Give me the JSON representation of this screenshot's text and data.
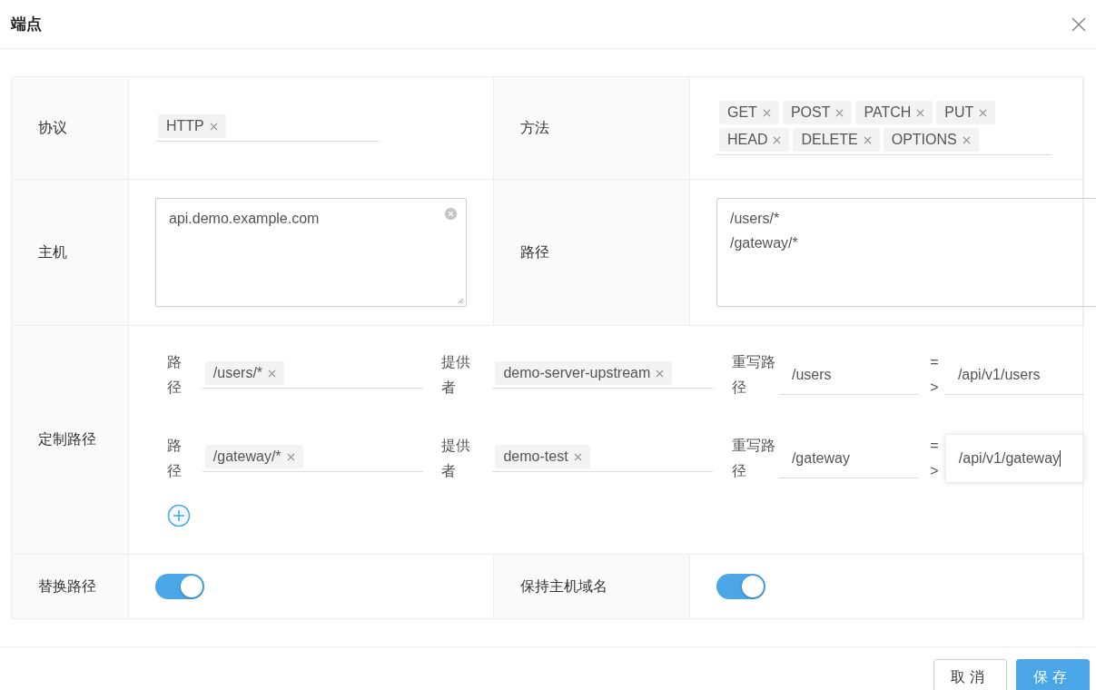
{
  "dialog": {
    "title": "端点"
  },
  "protocol": {
    "label": "协议",
    "tags": [
      "HTTP"
    ]
  },
  "methods": {
    "label": "方法",
    "tags": [
      "GET",
      "POST",
      "PATCH",
      "PUT",
      "HEAD",
      "DELETE",
      "OPTIONS"
    ]
  },
  "host": {
    "label": "主机",
    "value": "api.demo.example.com"
  },
  "paths": {
    "label": "路径",
    "lines": [
      "/users/*",
      "/gateway/*"
    ]
  },
  "custom_routes": {
    "label": "定制路径",
    "routes": [
      {
        "path_label": "路径",
        "path_tags": [
          "/users/*"
        ],
        "provider_label": "提供者",
        "provider_tags": [
          "demo-server-upstream"
        ],
        "rewrite_label": "重写路径",
        "rewrite_from": "/users",
        "arrow": "=>",
        "rewrite_to": "/api/v1/users",
        "focused": false
      },
      {
        "path_label": "路径",
        "path_tags": [
          "/gateway/*"
        ],
        "provider_label": "提供者",
        "provider_tags": [
          "demo-test"
        ],
        "rewrite_label": "重写路径",
        "rewrite_from": "/gateway",
        "arrow": "=>",
        "rewrite_to": "/api/v1/gateway",
        "focused": true
      }
    ]
  },
  "strip_path": {
    "label": "替换路径",
    "on": true
  },
  "preserve_host": {
    "label": "保持主机域名",
    "on": true
  },
  "buttons": [
    {
      "label": "取消",
      "kind": "default"
    },
    {
      "label": "保存",
      "kind": "primary"
    }
  ]
}
